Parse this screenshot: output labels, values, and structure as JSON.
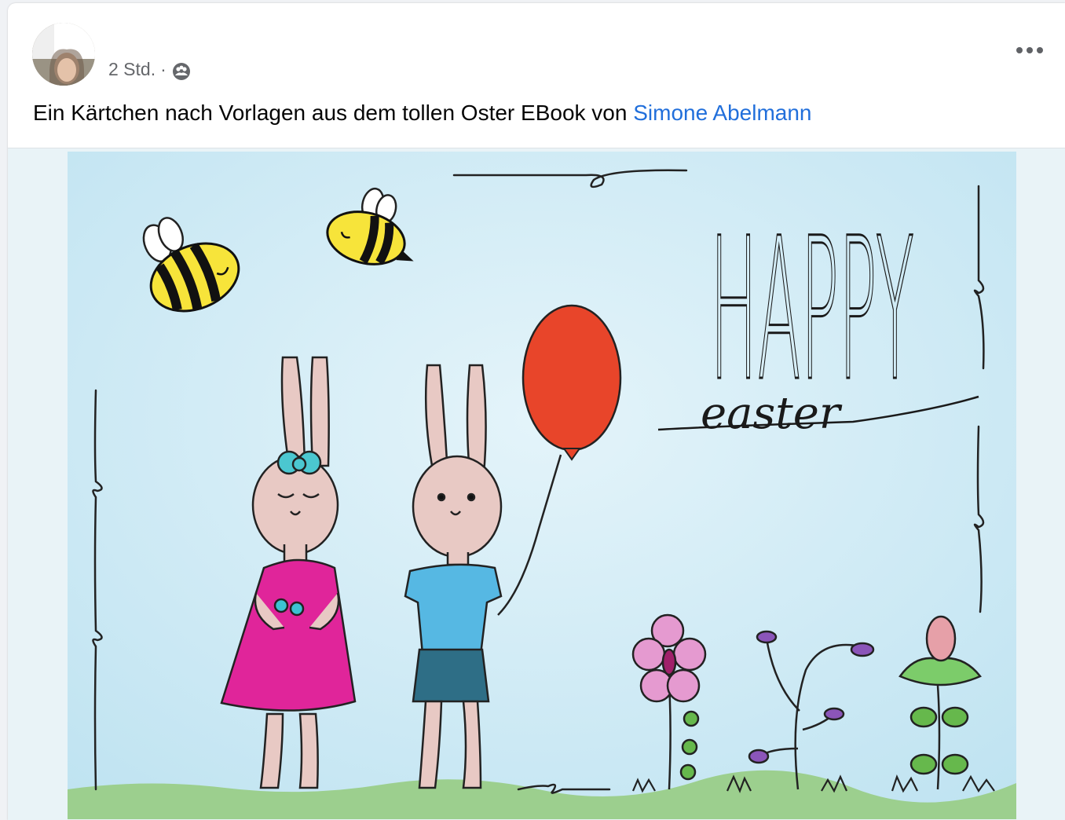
{
  "post": {
    "timestamp": "2 Std.",
    "separator": "·",
    "privacy_icon": "group-audience-icon",
    "more_icon": "more-options-icon",
    "caption_text": "Ein Kärtchen nach Vorlagen aus dem tollen Oster EBook von ",
    "caption_link": "Simone Abelmann",
    "link_color": "#216fdb"
  },
  "image": {
    "title_word": "HAPPY",
    "subtitle_word": "easter",
    "colors": {
      "sky": "#cfeaf5",
      "grass": "#9ccf8e",
      "dress": "#e0259a",
      "shirt": "#56b8e3",
      "balloon": "#e8452a",
      "bunny": "#e8c9c4"
    }
  }
}
